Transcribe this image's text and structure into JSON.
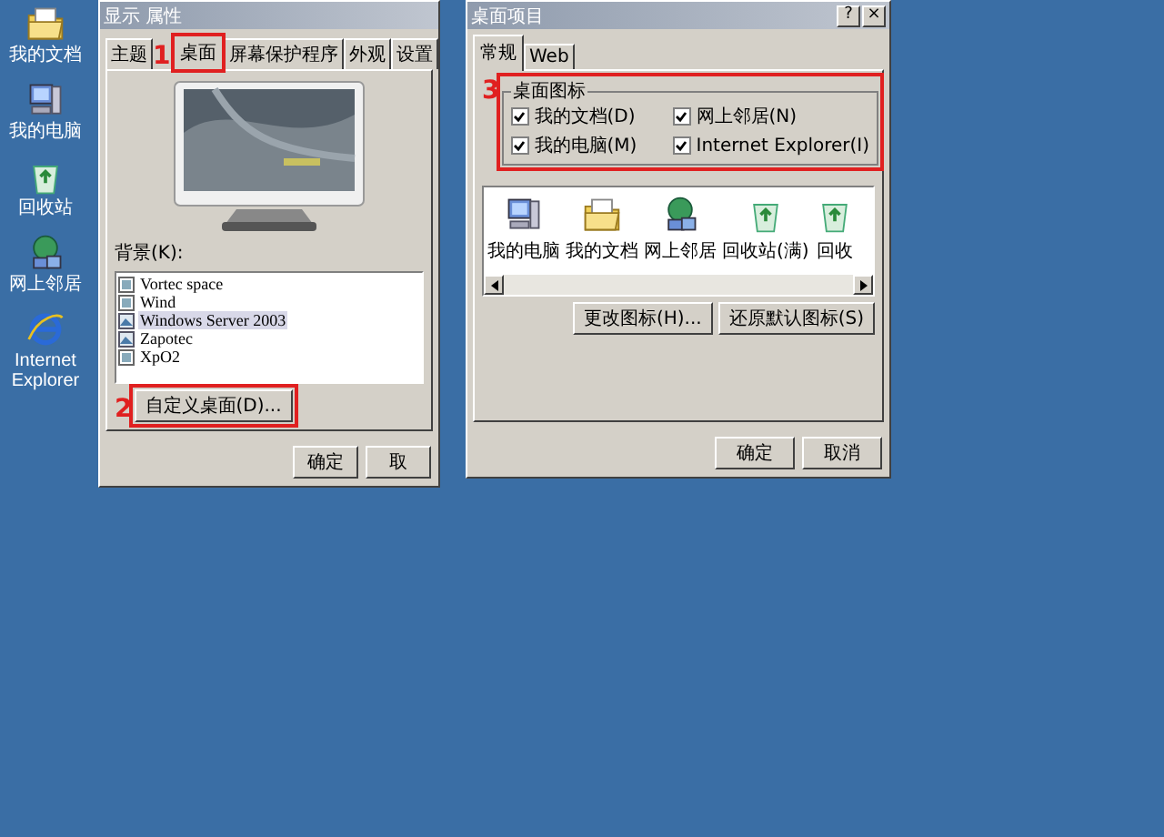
{
  "desktop_icons": [
    {
      "kind": "documents",
      "label": "我的文档"
    },
    {
      "kind": "computer",
      "label": "我的电脑"
    },
    {
      "kind": "recycle",
      "label": "回收站"
    },
    {
      "kind": "network",
      "label": "网上邻居"
    },
    {
      "kind": "ie",
      "label": "Internet Explorer"
    }
  ],
  "display_dialog": {
    "title": "显示 属性",
    "tabs": [
      {
        "label": "主题",
        "selected": false
      },
      {
        "label": "桌面",
        "selected": true,
        "callout": "1"
      },
      {
        "label": "屏幕保护程序",
        "selected": false
      },
      {
        "label": "外观",
        "selected": false
      },
      {
        "label": "设置",
        "selected": false
      }
    ],
    "background_label": "背景(K):",
    "backgrounds": [
      {
        "kind": "bitmap",
        "label": "Vortec space",
        "selected": false
      },
      {
        "kind": "bitmap",
        "label": "Wind",
        "selected": false
      },
      {
        "kind": "photo",
        "label": "Windows Server 2003",
        "selected": true
      },
      {
        "kind": "photo",
        "label": "Zapotec",
        "selected": false
      },
      {
        "kind": "bitmap",
        "label": "XpO2",
        "selected": false
      }
    ],
    "customize_button": {
      "label": "自定义桌面(D)...",
      "callout": "2"
    },
    "buttons": [
      "确定",
      "取"
    ]
  },
  "items_dialog": {
    "title": "桌面项目",
    "help": "?",
    "close": "×",
    "tabs": [
      {
        "label": "常规",
        "selected": true
      },
      {
        "label": "Web",
        "selected": false
      }
    ],
    "group": {
      "title": "桌面图标",
      "callout": "3",
      "checkboxes": [
        {
          "label": "我的文档(D)",
          "checked": true
        },
        {
          "label": "网上邻居(N)",
          "checked": true
        },
        {
          "label": "我的电脑(M)",
          "checked": true
        },
        {
          "label": "Internet Explorer(I)",
          "checked": true
        }
      ]
    },
    "icons": [
      {
        "kind": "computer",
        "label": "我的电脑"
      },
      {
        "kind": "documents",
        "label": "我的文档"
      },
      {
        "kind": "network",
        "label": "网上邻居"
      },
      {
        "kind": "recycle",
        "label": "回收站(满)"
      },
      {
        "kind": "recycle",
        "label": "回收"
      }
    ],
    "icon_buttons": [
      "更改图标(H)...",
      "还原默认图标(S)"
    ],
    "buttons": [
      "确定",
      "取消"
    ]
  }
}
